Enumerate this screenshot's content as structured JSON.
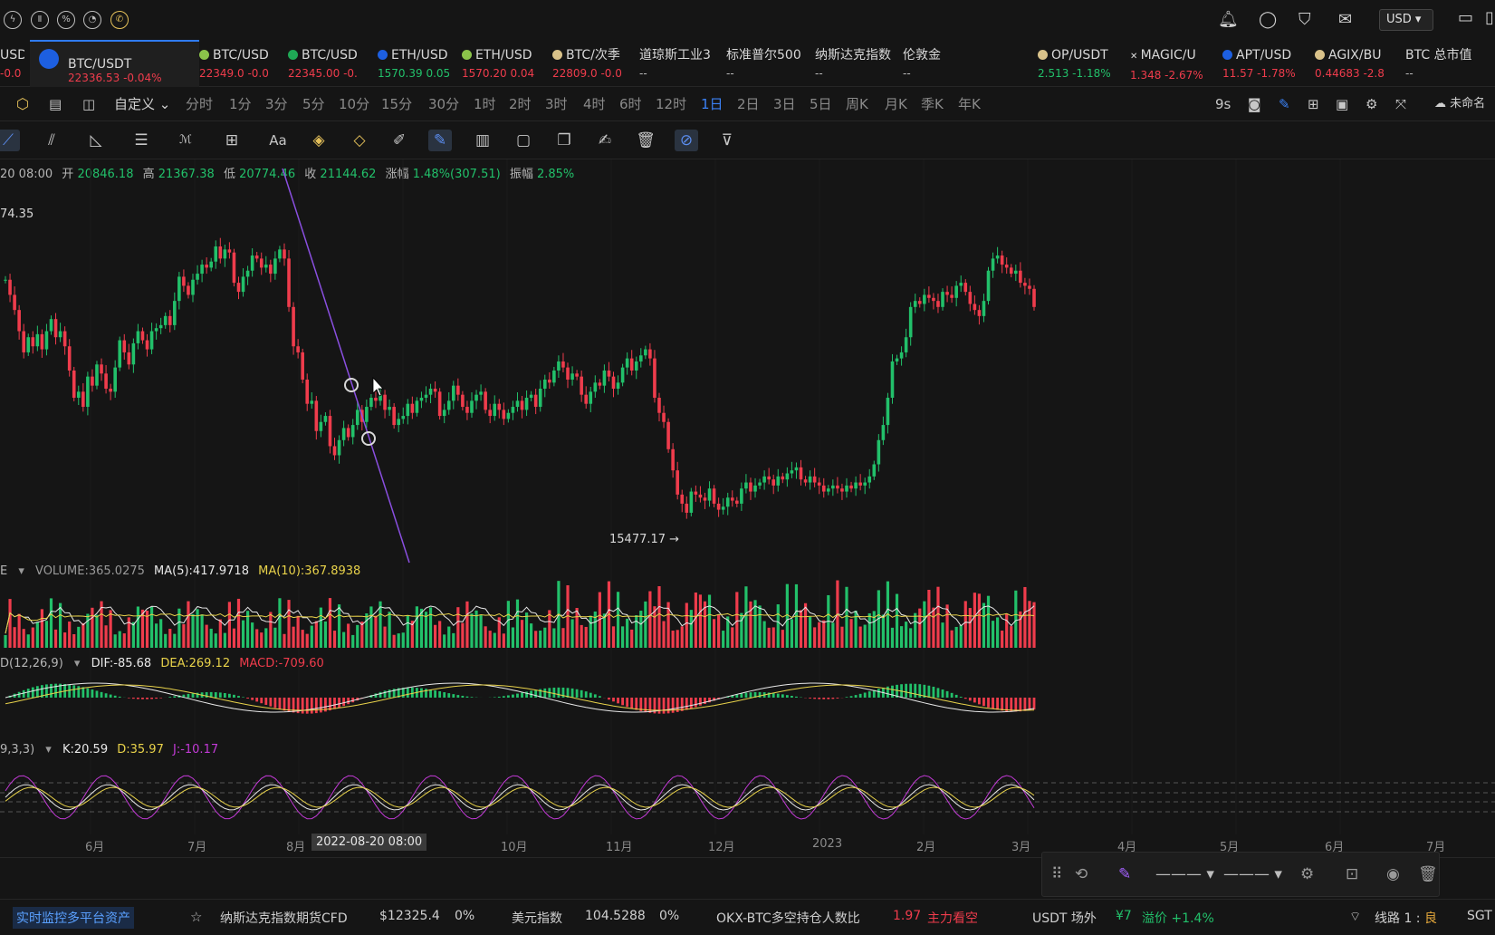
{
  "currency": "USD",
  "tickers": [
    {
      "name": "USD",
      "price": "-0.0",
      "dir": "dn",
      "dot": ""
    },
    {
      "name": "BTC/USDT",
      "price": "22336.53  -0.04%",
      "dir": "dn",
      "dot": "#1d5fe0",
      "active": true
    },
    {
      "name": "BTC/USD",
      "price": "22349.0  -0.0",
      "dir": "dn",
      "dot": "#8bc34a"
    },
    {
      "name": "BTC/USD",
      "price": "22345.00  -0.",
      "dir": "dn",
      "dot": "#1fa855"
    },
    {
      "name": "ETH/USD",
      "price": "1570.39  0.05",
      "dir": "up",
      "dot": "#1d5fe0"
    },
    {
      "name": "ETH/USD",
      "price": "1570.20  0.04",
      "dir": "dn",
      "dot": "#8bc34a"
    },
    {
      "name": "BTC/次季",
      "price": "22809.0  -0.0",
      "dir": "dn",
      "dot": "#d9c28a"
    },
    {
      "name": "道琼斯工业3",
      "price": "--",
      "dir": "",
      "dot": ""
    },
    {
      "name": "标准普尔500",
      "price": "--",
      "dir": "",
      "dot": ""
    },
    {
      "name": "纳斯达克指数",
      "price": "--",
      "dir": "",
      "dot": ""
    },
    {
      "name": "伦敦金",
      "price": "--",
      "dir": "",
      "dot": ""
    },
    {
      "name": "OP/USDT",
      "price": "2.513  -1.18%",
      "dir": "up",
      "dot": "#d9c28a"
    },
    {
      "name": "MAGIC/U",
      "price": "1.348  -2.67%",
      "dir": "dn",
      "dot": "x"
    },
    {
      "name": "APT/USD",
      "price": "11.57  -1.78%",
      "dir": "dn",
      "dot": "#1d5fe0"
    },
    {
      "name": "AGIX/BU",
      "price": "0.44683  -2.8",
      "dir": "dn",
      "dot": "#d9c28a"
    },
    {
      "name": "BTC 总市值",
      "price": "--",
      "dir": "",
      "dot": ""
    }
  ],
  "timeframes": [
    "分时",
    "1分",
    "3分",
    "5分",
    "10分",
    "15分",
    "30分",
    "1时",
    "2时",
    "3时",
    "4时",
    "6时",
    "12时",
    "1日",
    "2日",
    "3日",
    "5日",
    "周K",
    "月K",
    "季K",
    "年K"
  ],
  "active_timeframe": "1日",
  "custom_label": "自定义",
  "refresh": "9s",
  "layout_name": "未命名",
  "ohlc": {
    "date": "20 08:00",
    "open_label": "开",
    "open": "20846.18",
    "high_label": "高",
    "high": "21367.38",
    "low_label": "低",
    "low": "20774.46",
    "close_label": "收",
    "close": "21144.62",
    "change_label": "涨幅",
    "change": "1.48%(307.51)",
    "amp_label": "振幅",
    "amp": "2.85%"
  },
  "price_label_top": "74.35",
  "low_marker": "15477.17 →",
  "volume": {
    "name": "E",
    "vol": "VOLUME:365.0275",
    "ma5": "MA(5):417.9718",
    "ma10": "MA(10):367.8938"
  },
  "macd": {
    "name": "D(12,26,9)",
    "dif": "DIF:-85.68",
    "dea": "DEA:269.12",
    "macd": "MACD:-709.60"
  },
  "kdj": {
    "name": "9,3,3)",
    "k": "K:20.59",
    "d": "D:35.97",
    "j": "J:-10.17"
  },
  "x_axis": [
    "6月",
    "7月",
    "8月",
    "10月",
    "11月",
    "12月",
    "2023",
    "2月",
    "3月",
    "4月",
    "5月",
    "6月",
    "7月"
  ],
  "crosshair_date": "2022-08-20 08:00",
  "bottom": {
    "monitor": "实时监控多平台资产",
    "nasdaq_label": "纳斯达克指数期货CFD",
    "nasdaq_val": "$12325.4",
    "nasdaq_chg": "0%",
    "dxy_label": "美元指数",
    "dxy_val": "104.5288",
    "dxy_chg": "0%",
    "okx_label": "OKX-BTC多空持仓人数比",
    "okx_val": "1.97",
    "okx_status": "主力看空",
    "usdt_label": "USDT 场外",
    "usdt_val": "¥7",
    "premium": "溢价 +1.4%",
    "route": "线路 1 : ",
    "route_q": "良",
    "region": "SGT"
  },
  "colors": {
    "up": "#22c06a",
    "down": "#ef3c4c",
    "accent": "#3b82f6",
    "ma5": "#e8e8e8",
    "ma10": "#e8d24a",
    "j": "#c23ad6",
    "trend": "#8a4fe0"
  },
  "chart_data": {
    "type": "candlestick",
    "closes": [
      23600,
      23100,
      22600,
      21900,
      21200,
      21700,
      21400,
      21800,
      21300,
      21900,
      22300,
      21700,
      21900,
      21400,
      20600,
      19700,
      19900,
      19400,
      20400,
      20100,
      20800,
      20500,
      20000,
      19900,
      20700,
      21600,
      21200,
      20800,
      21500,
      21900,
      21600,
      21300,
      21900,
      22000,
      22100,
      22400,
      22100,
      22900,
      23700,
      23400,
      23100,
      23600,
      23800,
      24100,
      24000,
      24200,
      24700,
      24300,
      24600,
      24500,
      23500,
      23200,
      23700,
      23900,
      24400,
      24300,
      24000,
      24100,
      23800,
      24300,
      24600,
      24300,
      22700,
      21400,
      21200,
      20300,
      19500,
      19600,
      18600,
      18900,
      19100,
      18100,
      17800,
      18300,
      18700,
      18400,
      18800,
      19300,
      18900,
      19400,
      19700,
      19600,
      19800,
      19300,
      19400,
      18800,
      19000,
      19100,
      19500,
      19200,
      19600,
      19700,
      19800,
      20000,
      19900,
      19100,
      19300,
      19600,
      20100,
      19800,
      19400,
      19200,
      19600,
      19800,
      19900,
      19300,
      19100,
      19500,
      19300,
      19000,
      19200,
      19400,
      19600,
      19300,
      19700,
      19800,
      19400,
      20000,
      20300,
      20200,
      20600,
      20900,
      20700,
      20300,
      20500,
      20400,
      19800,
      19500,
      19900,
      20200,
      20100,
      20600,
      20400,
      20000,
      20200,
      20700,
      21000,
      20600,
      20900,
      21100,
      21300,
      21000,
      19700,
      19200,
      18900,
      18000,
      17300,
      16500,
      16200,
      15900,
      16600,
      16500,
      16400,
      16300,
      16700,
      16200,
      16000,
      16100,
      16400,
      16300,
      16200,
      16700,
      16900,
      16600,
      16800,
      16900,
      17100,
      17000,
      16800,
      17100,
      17000,
      17200,
      17300,
      17400,
      17000,
      16900,
      17100,
      16900,
      16800,
      16600,
      16700,
      16800,
      16700,
      16600,
      16800,
      16700,
      16900,
      16800,
      16900,
      17100,
      17500,
      18300,
      18800,
      19700,
      20900,
      21000,
      21200,
      21700,
      22700,
      22900,
      22800,
      23100,
      23000,
      22900,
      22700,
      23200,
      23100,
      23000,
      23400,
      23500,
      23200,
      22800,
      22600,
      22400,
      22900,
      23900,
      24300,
      24400,
      24100,
      24000,
      23800,
      23900,
      23500,
      23400,
      23300,
      22700
    ],
    "ylim": [
      15000,
      25000
    ],
    "low_label": "15477.17"
  }
}
